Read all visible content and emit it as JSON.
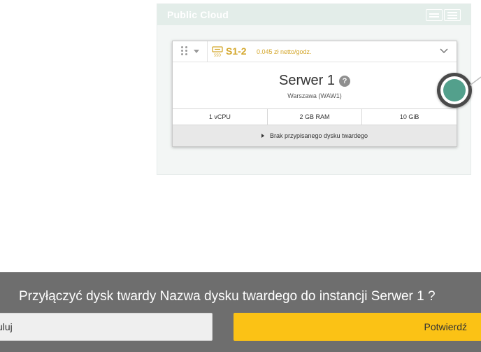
{
  "panel": {
    "title": "Public Cloud",
    "view_icons": [
      "list-view-icon",
      "grid-view-icon"
    ]
  },
  "server_card": {
    "flavor": "S1-2",
    "price": "0.045 zł netto/godz.",
    "name": "Serwer 1",
    "help_symbol": "?",
    "location": "Warszawa (WAW1)",
    "specs": [
      "1 vCPU",
      "2 GB RAM",
      "10 GiB"
    ],
    "disk_status": "Brak przypisanego dysku twardego",
    "icons": [
      "drag-handle-icon",
      "dropdown-caret-icon",
      "ssd-icon",
      "chevron-down-icon",
      "help-icon",
      "caret-right-icon"
    ]
  },
  "confirm_bar": {
    "question": "Przyłączyć dysk twardy Nazwa dysku twardego do instancji Serwer 1 ?",
    "cancel_label": "uluj",
    "confirm_label": "Potwierdź"
  },
  "colors": {
    "accent": "#d4a72c",
    "confirm_button": "#fbc215",
    "connector": "#53a08c",
    "overlay_bar": "#6e6e6e"
  }
}
